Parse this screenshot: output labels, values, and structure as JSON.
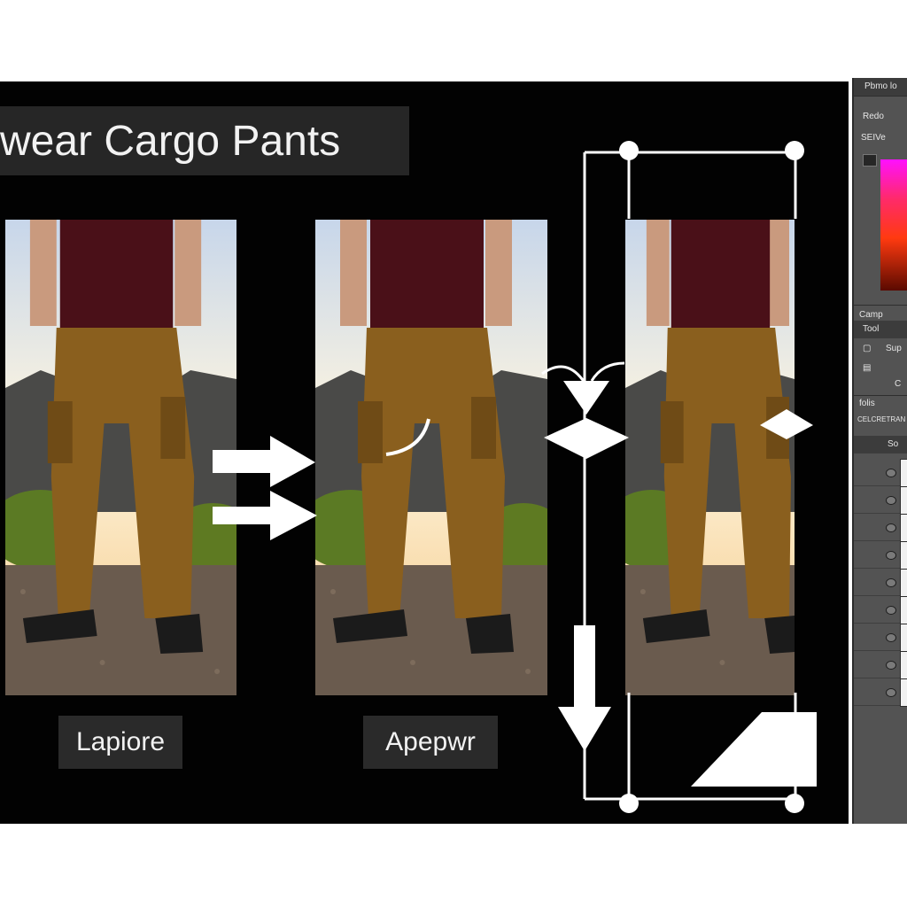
{
  "canvas": {
    "title": "wear Cargo Pants",
    "photos": [
      {
        "label": ""
      },
      {
        "label": ""
      },
      {
        "label": ""
      }
    ],
    "captions": [
      "Lapiore",
      "Apepwr"
    ]
  },
  "panel": {
    "header_title": "Pbmo lo",
    "color_tab": "Redo",
    "color_sub": "SEIVe",
    "section_label": "Camp",
    "tools_label": "Tool",
    "tools_button": "Sup",
    "tools_c": "C",
    "layers_label": "folis",
    "layers_sub": "CELCRETRAN",
    "layers_header": "So"
  },
  "colors": {
    "canvas_bg": "#020202",
    "title_bg": "#262626",
    "panel_bg": "#535353",
    "pants": "#8a5f1e",
    "shirt": "#4a1018"
  }
}
